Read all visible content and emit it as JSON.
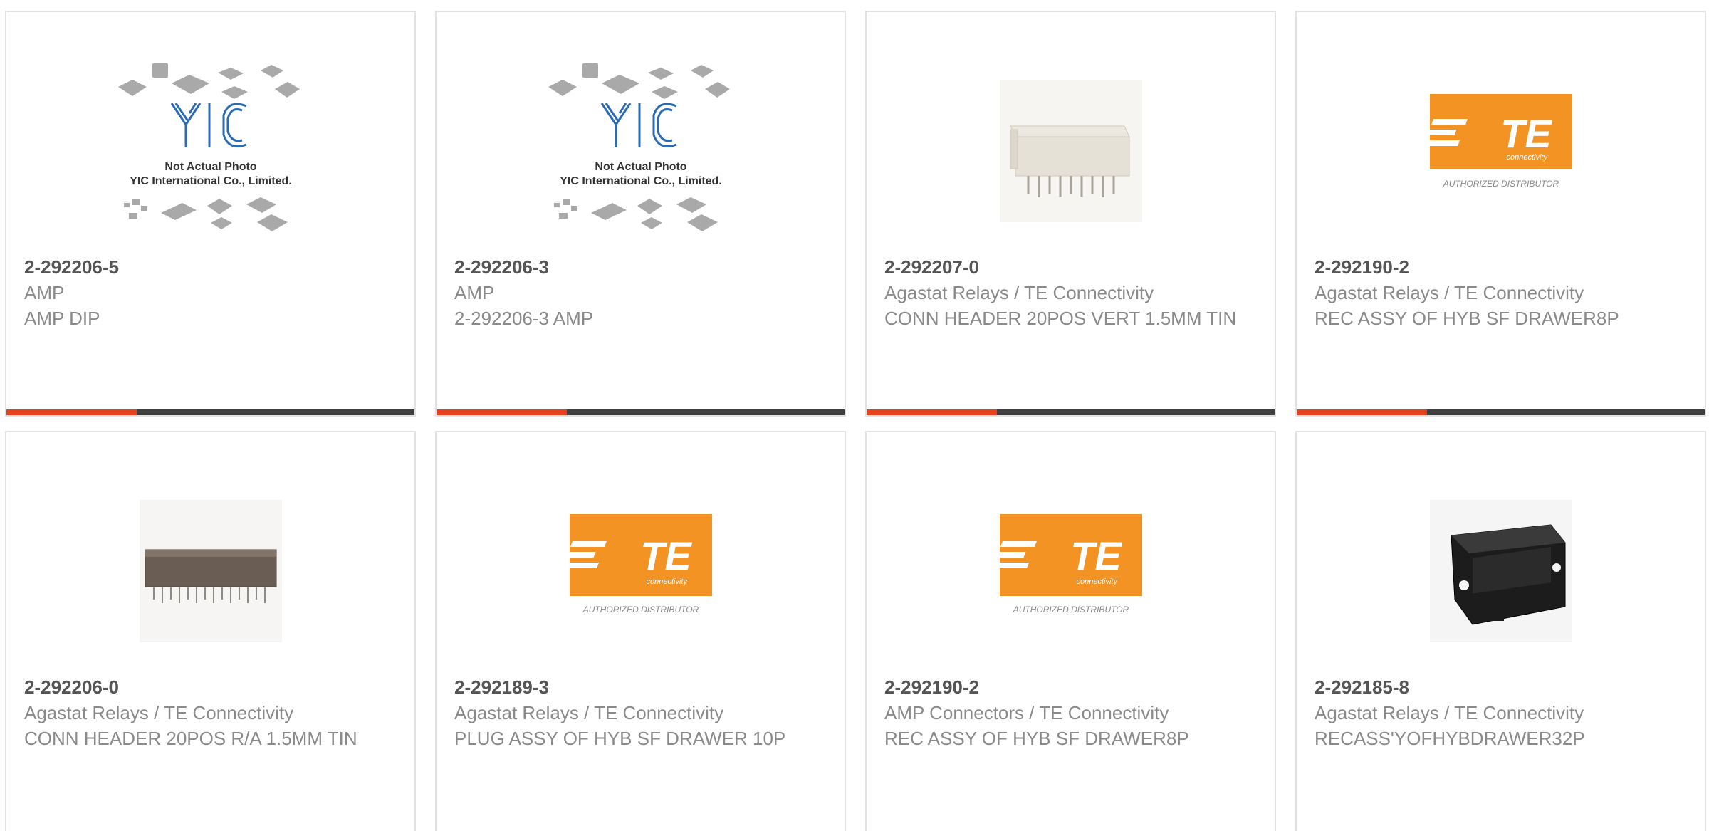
{
  "products": [
    {
      "part_number": "2-292206-5",
      "manufacturer": "AMP",
      "description": "AMP DIP",
      "image": "yic-placeholder"
    },
    {
      "part_number": "2-292206-3",
      "manufacturer": "AMP",
      "description": "2-292206-3 AMP",
      "image": "yic-placeholder"
    },
    {
      "part_number": "2-292207-0",
      "manufacturer": "Agastat Relays / TE Connectivity",
      "description": "CONN HEADER 20POS VERT 1.5MM TIN",
      "image": "white-header-connector"
    },
    {
      "part_number": "2-292190-2",
      "manufacturer": "Agastat Relays / TE Connectivity",
      "description": "REC ASSY OF HYB SF DRAWER8P",
      "image": "te-logo"
    },
    {
      "part_number": "2-292206-0",
      "manufacturer": "Agastat Relays / TE Connectivity",
      "description": "CONN HEADER 20POS R/A 1.5MM TIN",
      "image": "brown-header-connector"
    },
    {
      "part_number": "2-292189-3",
      "manufacturer": "Agastat Relays / TE Connectivity",
      "description": "PLUG ASSY OF HYB SF DRAWER 10P",
      "image": "te-logo"
    },
    {
      "part_number": "2-292190-2",
      "manufacturer": "AMP Connectors / TE Connectivity",
      "description": "REC ASSY OF HYB SF DRAWER8P",
      "image": "te-logo"
    },
    {
      "part_number": "2-292185-8",
      "manufacturer": "Agastat Relays / TE Connectivity",
      "description": "RECASS'YOFHYBDRAWER32P",
      "image": "black-drawer-connector"
    }
  ],
  "placeholder": {
    "brand": "YIC",
    "line1": "Not Actual Photo",
    "line2": "YIC International Co., Limited."
  },
  "te_logo": {
    "mark": "TE",
    "sub": "connectivity",
    "caption": "AUTHORIZED DISTRIBUTOR"
  },
  "colors": {
    "accent": "#e8401a",
    "bar": "#3f3f3f",
    "te_orange": "#f39323",
    "part_number": "#555555",
    "text": "#8a8a8a",
    "border": "#e2e2e2"
  }
}
